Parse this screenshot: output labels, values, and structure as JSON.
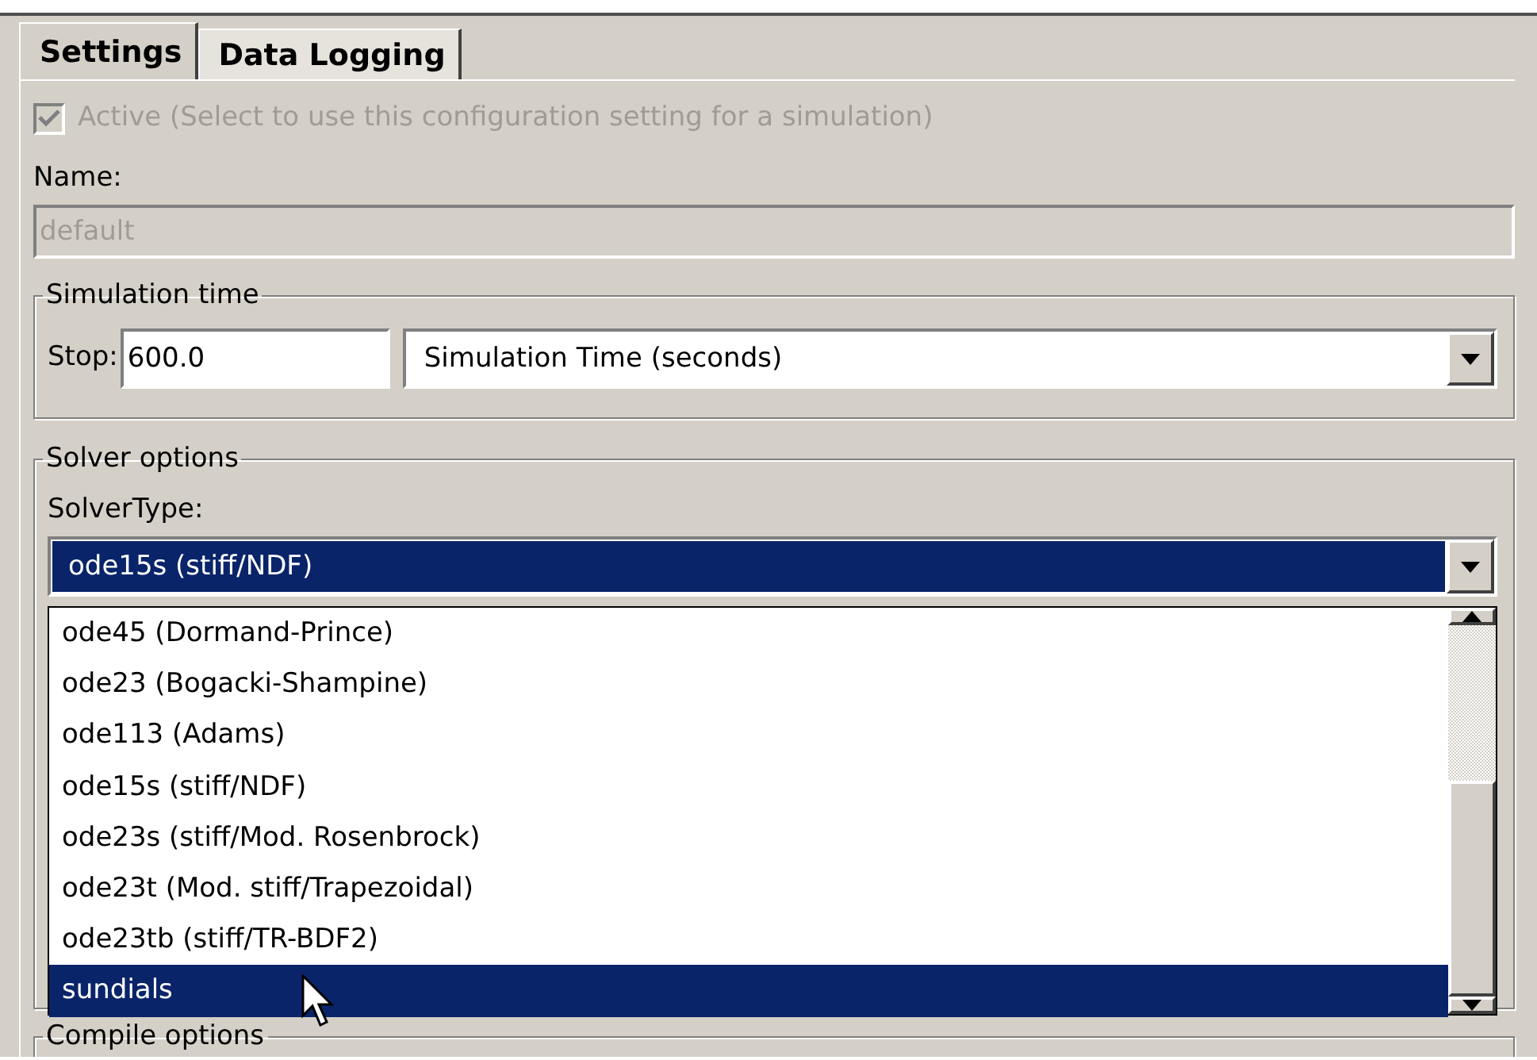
{
  "tabs": [
    {
      "label": "Settings",
      "selected": true
    },
    {
      "label": "Data Logging",
      "selected": false
    }
  ],
  "active_checkbox": {
    "label": "Active (Select to use this configuration setting for a simulation)",
    "checked": true,
    "disabled": true
  },
  "name": {
    "label": "Name:",
    "value": "default",
    "disabled": true
  },
  "simulation_time": {
    "legend": "Simulation time",
    "stop_label": "Stop:",
    "stop_value": "600.0",
    "units": "Simulation Time (seconds)"
  },
  "solver_options": {
    "legend": "Solver options",
    "solver_type_label": "SolverType:",
    "solver_type_value": "ode15s (stiff/NDF)",
    "focused": true,
    "dropdown_items": [
      {
        "label": "ode45 (Dormand-Prince)",
        "selected": false
      },
      {
        "label": "ode23 (Bogacki-Shampine)",
        "selected": false
      },
      {
        "label": "ode113 (Adams)",
        "selected": false
      },
      {
        "label": "ode15s (stiff/NDF)",
        "selected": false
      },
      {
        "label": "ode23s (stiff/Mod. Rosenbrock)",
        "selected": false
      },
      {
        "label": "ode23t (Mod. stiff/Trapezoidal)",
        "selected": false
      },
      {
        "label": "ode23tb (stiff/TR-BDF2)",
        "selected": false
      },
      {
        "label": "sundials",
        "selected": true
      }
    ]
  },
  "compile_options": {
    "legend": "Compile options"
  }
}
